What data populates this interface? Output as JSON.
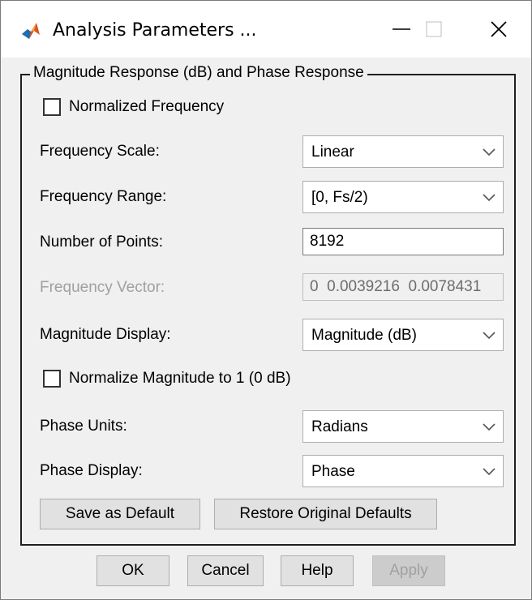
{
  "window": {
    "title": "Analysis Parameters ..."
  },
  "group": {
    "legend": "Magnitude Response (dB) and Phase Response"
  },
  "normalized_frequency": {
    "label": "Normalized Frequency",
    "checked": false
  },
  "frequency_scale": {
    "label": "Frequency Scale:",
    "value": "Linear"
  },
  "frequency_range": {
    "label": "Frequency Range:",
    "value": "[0, Fs/2)"
  },
  "number_of_points": {
    "label": "Number of Points:",
    "value": "8192"
  },
  "frequency_vector": {
    "label": "Frequency Vector:",
    "value": "0  0.0039216  0.0078431"
  },
  "magnitude_display": {
    "label": "Magnitude Display:",
    "value": "Magnitude (dB)"
  },
  "normalize_magnitude": {
    "label": "Normalize Magnitude to 1 (0 dB)",
    "checked": false
  },
  "phase_units": {
    "label": "Phase Units:",
    "value": "Radians"
  },
  "phase_display": {
    "label": "Phase Display:",
    "value": "Phase"
  },
  "group_buttons": {
    "save_default": "Save as Default",
    "restore_defaults": "Restore Original Defaults"
  },
  "footer_buttons": {
    "ok": "OK",
    "cancel": "Cancel",
    "help": "Help",
    "apply": "Apply"
  },
  "icons": {
    "app": "matlab-icon",
    "minimize": "minimize-icon",
    "maximize": "maximize-icon",
    "close": "close-icon",
    "dropdown": "chevron-down-icon"
  }
}
